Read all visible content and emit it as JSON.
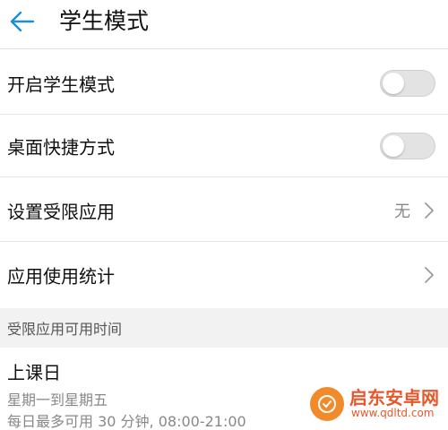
{
  "header": {
    "title": "学生模式",
    "back_icon": "arrow-left-icon"
  },
  "settings": [
    {
      "label": "开启学生模式",
      "control": "toggle",
      "enabled": false
    },
    {
      "label": "桌面快捷方式",
      "control": "toggle",
      "enabled": false
    },
    {
      "label": "设置受限应用",
      "control": "chevron",
      "value": "无"
    },
    {
      "label": "应用使用统计",
      "control": "chevron"
    }
  ],
  "section": {
    "title": "受限应用可用时间"
  },
  "schedule": {
    "title": "上课日",
    "days": "星期一到星期五",
    "detail": "每日最多可用 30 分钟, 08:00-21:00"
  },
  "watermark": {
    "name": "启东安卓网",
    "url": "www.qdltd.com"
  },
  "colors": {
    "accent": "#1a8fd8",
    "toggle_off": "#e3e3e3",
    "secondary_text": "#888888",
    "watermark": "#e8562a"
  }
}
